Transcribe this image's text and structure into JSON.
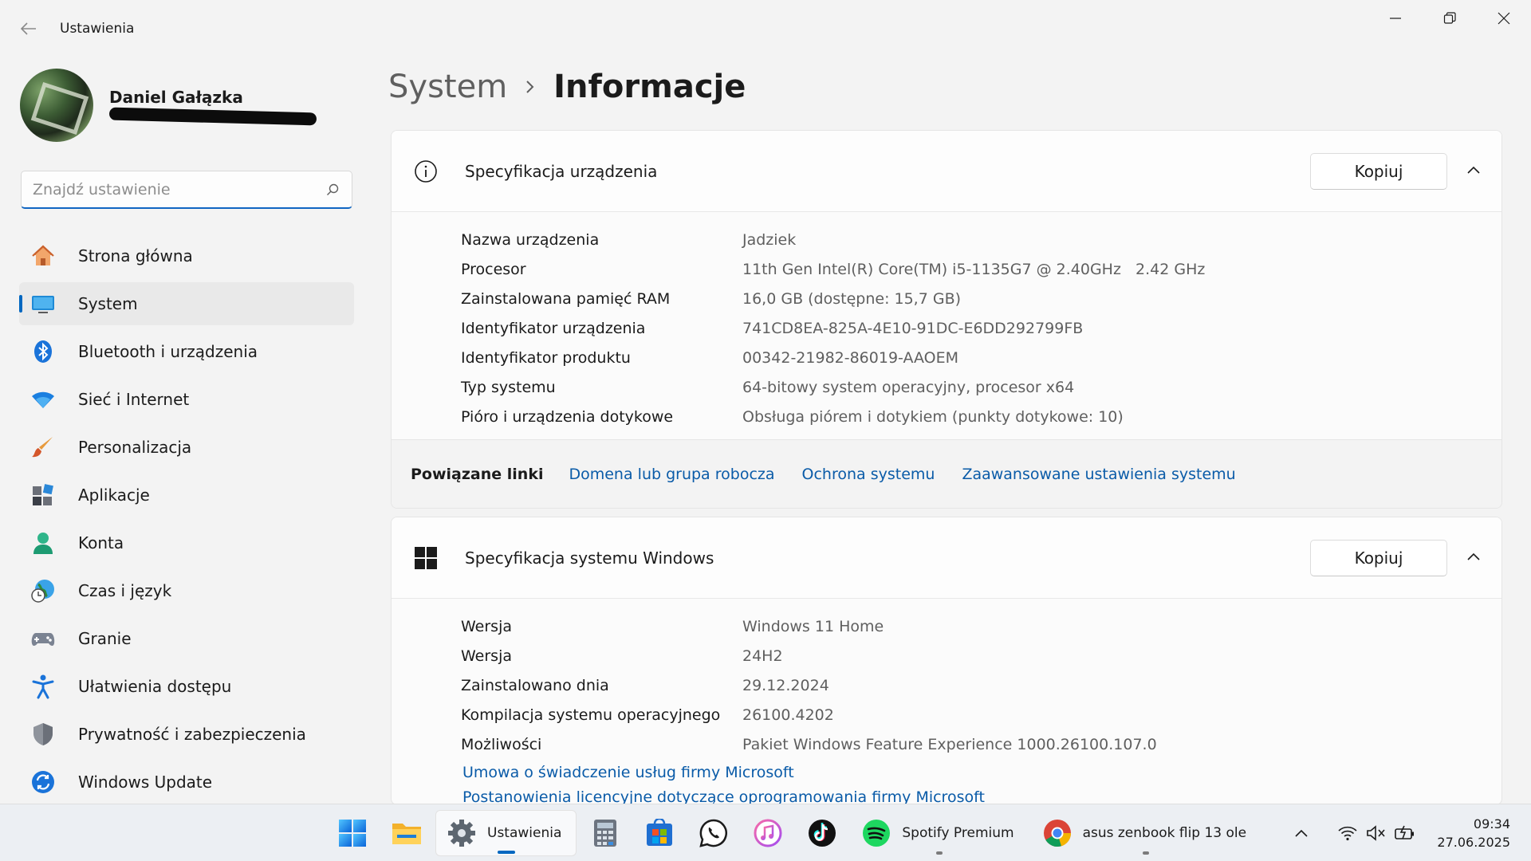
{
  "window": {
    "title": "Ustawienia"
  },
  "profile": {
    "name": "Daniel Gałązka"
  },
  "search": {
    "placeholder": "Znajdź ustawienie"
  },
  "nav": {
    "items": [
      {
        "label": "Strona główna",
        "icon": "home-icon"
      },
      {
        "label": "System",
        "icon": "monitor-icon",
        "active": true
      },
      {
        "label": "Bluetooth i urządzenia",
        "icon": "bluetooth-icon"
      },
      {
        "label": "Sieć i Internet",
        "icon": "wifi-icon"
      },
      {
        "label": "Personalizacja",
        "icon": "brush-icon"
      },
      {
        "label": "Aplikacje",
        "icon": "apps-icon"
      },
      {
        "label": "Konta",
        "icon": "person-icon"
      },
      {
        "label": "Czas i język",
        "icon": "clock-globe-icon"
      },
      {
        "label": "Granie",
        "icon": "gamepad-icon"
      },
      {
        "label": "Ułatwienia dostępu",
        "icon": "accessibility-icon"
      },
      {
        "label": "Prywatność i zabezpieczenia",
        "icon": "shield-icon"
      },
      {
        "label": "Windows Update",
        "icon": "update-icon"
      }
    ]
  },
  "breadcrumb": {
    "parent": "System",
    "current": "Informacje"
  },
  "device_spec": {
    "title": "Specyfikacja urządzenia",
    "copy_label": "Kopiuj",
    "rows": [
      {
        "key": "Nazwa urządzenia",
        "value": "Jadziek"
      },
      {
        "key": "Procesor",
        "value": "11th Gen Intel(R) Core(TM) i5-1135G7 @ 2.40GHz   2.42 GHz"
      },
      {
        "key": "Zainstalowana pamięć RAM",
        "value": "16,0 GB (dostępne: 15,7 GB)"
      },
      {
        "key": "Identyfikator urządzenia",
        "value": "741CD8EA-825A-4E10-91DC-E6DD292799FB"
      },
      {
        "key": "Identyfikator produktu",
        "value": "00342-21982-86019-AAOEM"
      },
      {
        "key": "Typ systemu",
        "value": "64-bitowy system operacyjny, procesor x64"
      },
      {
        "key": "Pióro i urządzenia dotykowe",
        "value": "Obsługa piórem i dotykiem (punkty dotykowe: 10)"
      }
    ]
  },
  "related": {
    "title": "Powiązane linki",
    "links": [
      "Domena lub grupa robocza",
      "Ochrona systemu",
      "Zaawansowane ustawienia systemu"
    ]
  },
  "windows_spec": {
    "title": "Specyfikacja systemu Windows",
    "copy_label": "Kopiuj",
    "rows": [
      {
        "key": "Wersja",
        "value": "Windows 11 Home"
      },
      {
        "key": "Wersja",
        "value": "24H2"
      },
      {
        "key": "Zainstalowano dnia",
        "value": "29.12.2024"
      },
      {
        "key": "Kompilacja systemu operacyjnego",
        "value": "26100.4202"
      },
      {
        "key": "Możliwości",
        "value": "Pakiet Windows Feature Experience 1000.26100.107.0"
      }
    ],
    "links": [
      "Umowa o świadczenie usług firmy Microsoft",
      "Postanowienia licencyjne dotyczące oprogramowania firmy Microsoft"
    ]
  },
  "taskbar": {
    "apps": [
      {
        "name": "start-button",
        "icon": "windows-logo-icon"
      },
      {
        "name": "file-explorer",
        "icon": "folder-icon"
      },
      {
        "name": "settings",
        "icon": "gear-icon",
        "label": "Ustawienia",
        "active": true
      },
      {
        "name": "calculator",
        "icon": "calculator-icon"
      },
      {
        "name": "microsoft-store",
        "icon": "store-icon"
      },
      {
        "name": "whatsapp",
        "icon": "whatsapp-icon"
      },
      {
        "name": "itunes",
        "icon": "music-note-icon"
      },
      {
        "name": "tiktok",
        "icon": "tiktok-icon"
      },
      {
        "name": "spotify",
        "icon": "spotify-icon",
        "label": "Spotify Premium"
      },
      {
        "name": "chrome",
        "icon": "chrome-icon",
        "label": "asus zenbook flip 13 ole"
      }
    ],
    "clock": {
      "time": "09:34",
      "date": "27.06.2025"
    }
  },
  "colors": {
    "accent": "#0067c0",
    "link": "#0a5ba8",
    "background": "#f3f3f3"
  }
}
